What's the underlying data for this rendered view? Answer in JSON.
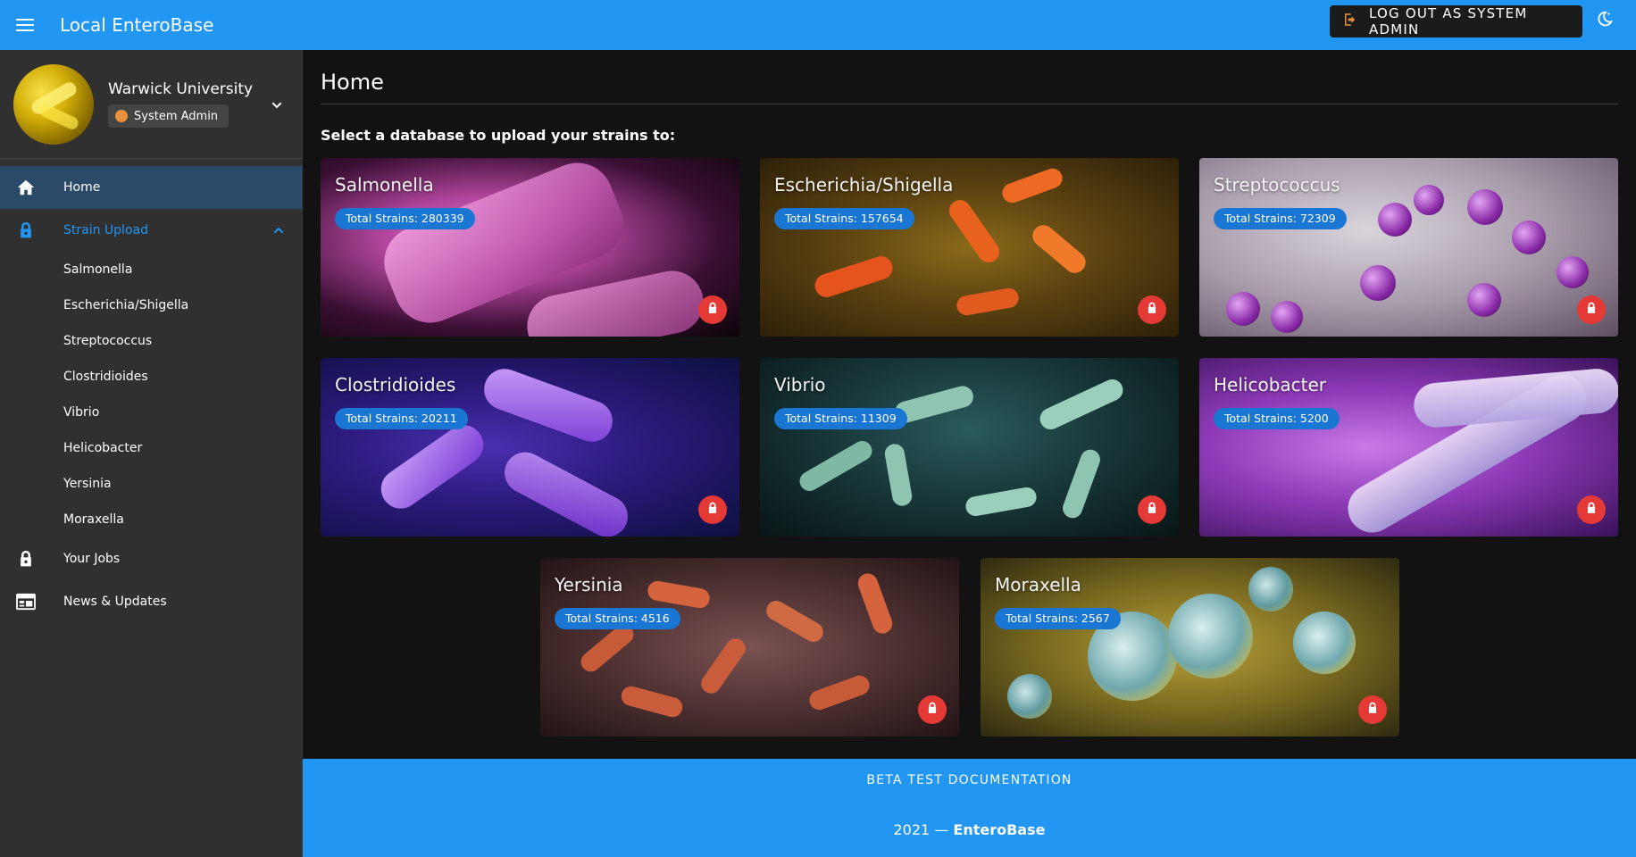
{
  "appbar": {
    "title": "Local EnteroBase",
    "logout_label": "LOG OUT AS SYSTEM ADMIN",
    "icons": {
      "menu": "hamburger-menu-icon",
      "logout": "logout-icon",
      "theme": "dark-mode-icon"
    }
  },
  "sidebar": {
    "profile": {
      "name": "Warwick University",
      "role": "System Admin"
    },
    "items": [
      {
        "label": "Home",
        "icon": "home-icon"
      },
      {
        "label": "Strain Upload",
        "icon": "lock-icon"
      },
      {
        "label": "Your Jobs",
        "icon": "lock-icon"
      },
      {
        "label": "News & Updates",
        "icon": "news-icon"
      }
    ],
    "strain_upload_children": [
      "Salmonella",
      "Escherichia/Shigella",
      "Streptococcus",
      "Clostridioides",
      "Vibrio",
      "Helicobacter",
      "Yersinia",
      "Moraxella"
    ]
  },
  "main": {
    "title": "Home",
    "subtitle": "Select a database to upload your strains to:",
    "cards": [
      {
        "name": "Salmonella",
        "count": "Total Strains: 280339"
      },
      {
        "name": "Escherichia/Shigella",
        "count": "Total Strains: 157654"
      },
      {
        "name": "Streptococcus",
        "count": "Total Strains: 72309"
      },
      {
        "name": "Clostridioides",
        "count": "Total Strains: 20211"
      },
      {
        "name": "Vibrio",
        "count": "Total Strains: 11309"
      },
      {
        "name": "Helicobacter",
        "count": "Total Strains: 5200"
      },
      {
        "name": "Yersinia",
        "count": "Total Strains: 4516"
      },
      {
        "name": "Moraxella",
        "count": "Total Strains: 2567"
      }
    ]
  },
  "footer": {
    "link": "BETA TEST DOCUMENTATION",
    "year": "2021 —",
    "brand": "EnteroBase"
  },
  "colors": {
    "primary": "#2196f3",
    "background": "#121212",
    "sidebar": "#303030",
    "chip": "#1976d2",
    "lock": "#e53935"
  }
}
